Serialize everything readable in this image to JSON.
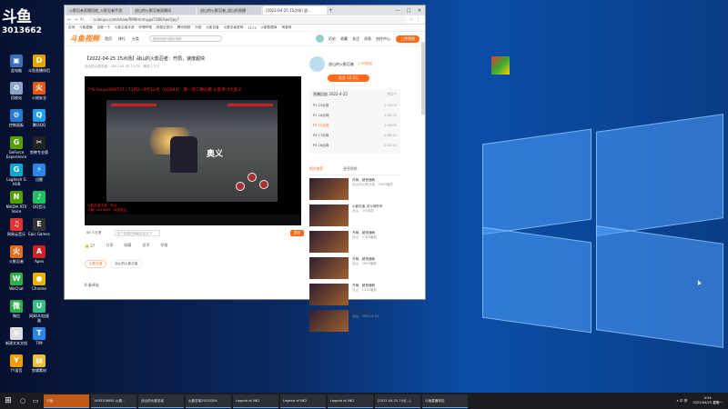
{
  "overlay": {
    "logo_text": "斗鱼",
    "room_id": "3013662"
  },
  "desktop_icons": [
    {
      "label": "此电脑",
      "color": "#3a6fb8",
      "glyph": "▣"
    },
    {
      "label": "斗鱼直播伴侣",
      "color": "#e2a400",
      "glyph": "D"
    },
    {
      "label": "回收站",
      "color": "#8aa5c8",
      "glyph": "♻"
    },
    {
      "label": "火绒安全",
      "color": "#e05a16",
      "glyph": "火"
    },
    {
      "label": "控制面板",
      "color": "#2a7bd0",
      "glyph": "⚙"
    },
    {
      "label": "腾讯QQ",
      "color": "#1ea0f0",
      "glyph": "Q"
    },
    {
      "label": "GeForce Experience",
      "color": "#55a000",
      "glyph": "G"
    },
    {
      "label": "剪映专业版",
      "color": "#222",
      "glyph": "✂"
    },
    {
      "label": "Logitech G HUB",
      "color": "#0aa6d4",
      "glyph": "G"
    },
    {
      "label": "迅雷",
      "color": "#2a86e6",
      "glyph": "⚡"
    },
    {
      "label": "NVIDIA RTX Voice",
      "color": "#55a000",
      "glyph": "N"
    },
    {
      "label": "QQ音乐",
      "color": "#20c060",
      "glyph": "♪"
    },
    {
      "label": "网易云音乐",
      "color": "#d33",
      "glyph": "♫"
    },
    {
      "label": "Epic Games",
      "color": "#333",
      "glyph": "E"
    },
    {
      "label": "火影忍者",
      "color": "#e07020",
      "glyph": "火"
    },
    {
      "label": "Apex",
      "color": "#c22",
      "glyph": "A"
    },
    {
      "label": "WeChat",
      "color": "#2bb14a",
      "glyph": "W"
    },
    {
      "label": "Chrome",
      "color": "#e8b000",
      "glyph": "●"
    },
    {
      "label": "微信",
      "color": "#2bb14a",
      "glyph": "微"
    },
    {
      "label": "网易UU加速器",
      "color": "#3b8",
      "glyph": "U"
    },
    {
      "label": "新建文本文档",
      "color": "#ddd",
      "glyph": "≡"
    },
    {
      "label": "TIM",
      "color": "#2a86e6",
      "glyph": "T"
    },
    {
      "label": "YY语音",
      "color": "#f0a000",
      "glyph": "Y"
    },
    {
      "label": "剪辑素材",
      "color": "#e8c040",
      "glyph": "▤"
    }
  ],
  "browser": {
    "tabs": [
      "火影忍者直播回放_火影忍者手游",
      "战山的火影忍者直播间",
      "战山的火影忍者_战山的直播",
      "[2022-04-25 15点场] 战...",
      "+"
    ],
    "url": "v.douyu.com/show/RM8mnmygo7O0EXwrGpy?",
    "bookmarks": [
      "应用",
      "斗鱼直播",
      "百度一下",
      "火影忍者手游",
      "哔哩哔哩",
      "网易云音乐",
      "腾讯视频",
      "抖音",
      "火影忍者",
      "火影忍者官网",
      "5173",
      "火影数据库",
      "淘宝网"
    ],
    "site": {
      "logo": "斗鱼视频",
      "nav": [
        "首页",
        "排行",
        "分类"
      ],
      "search_placeholder": "搜索你感兴趣的视频",
      "right": [
        "历史",
        "收藏",
        "关注",
        "消息",
        "创作中心"
      ],
      "upload": "上传视频"
    },
    "video": {
      "title": "【2022-04-25 15点场】战山的火影忍者：开局，速度超快",
      "meta": "战山的火影忍者 · 2022-04-25 15:00 · 播放 1.3万",
      "banner": "7*8 douyu999737 / 11月2~9点12点（QQ944）  唐一周二晚必看  火影单:4大奥义",
      "skill_text": "奥义",
      "sub_lines": [
        "火影忍者手游 · 战山",
        "斗鱼: 3013662 · 欢迎关注"
      ],
      "danmu_placeholder": "发个友善的弹幕见证当下",
      "send": "发送",
      "viewers": "68 人在看",
      "likes": "27",
      "actions": [
        "27",
        "分享",
        "收藏",
        "投币",
        "举报"
      ],
      "tags": [
        "火影忍者",
        "战山的火影忍者"
      ],
      "comments": "0 条评论"
    },
    "uploader": {
      "name": "战山的火影忍者",
      "fans": "1.3万粉丝",
      "follow": "关注 15.2万"
    },
    "playlist": {
      "header": "直播回放 2022-4-25",
      "count": "共5个",
      "items": [
        {
          "title": "P1 15点场",
          "dur": "1:02:03",
          "current": false
        },
        {
          "title": "P2 16点场",
          "dur": "1:00:20",
          "current": false
        },
        {
          "title": "P3 15点场",
          "dur": "1:00:05",
          "current": true
        },
        {
          "title": "P4 17点场",
          "dur": "0:58:41",
          "current": false
        },
        {
          "title": "P5 18点场",
          "dur": "0:42:10",
          "current": false
        }
      ]
    },
    "rec_tabs": [
      "相关推荐",
      "更多视频"
    ],
    "recommendations": [
      {
        "title": "开局，超快速刷",
        "meta": "战山的火影忍者 · 3589播放"
      },
      {
        "title": "火影忍者 决斗场秒杀",
        "meta": "战山 · 2分钟前"
      },
      {
        "title": "开局，超快速刷",
        "meta": "战山 · 2786播放"
      },
      {
        "title": "开局，超快速刷",
        "meta": "战山 · 2654播放"
      },
      {
        "title": "开局，超快速刷",
        "meta": "战山 · 1234播放"
      },
      {
        "title": "战山的火影忍者",
        "meta": "战山 · 2022-4-25"
      }
    ]
  },
  "taskbar": {
    "items": [
      "斗鱼",
      "1493106081-火影...",
      "战山的火影忍者",
      "火影忍者2022月04",
      "Legend of NK2",
      "Legend of NK2",
      "Legend of NK2",
      "[2022-04-25 15点...]",
      "斗鱼直播伴侣"
    ],
    "tray": "∧ 中 拼",
    "time": "4:34",
    "date": "2022/04/25 星期一"
  }
}
